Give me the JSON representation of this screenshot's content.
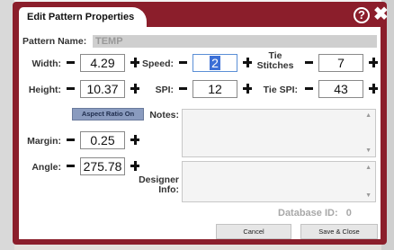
{
  "dialog": {
    "title": "Edit Pattern Properties",
    "help_icon": "?",
    "close_icon": "✖"
  },
  "pattern_name": {
    "label": "Pattern Name:",
    "value": "TEMP"
  },
  "fields": {
    "width": {
      "label": "Width:",
      "value": "4.29"
    },
    "height": {
      "label": "Height:",
      "value": "10.37"
    },
    "speed": {
      "label": "Speed:",
      "value": "2"
    },
    "spi": {
      "label": "SPI:",
      "value": "12"
    },
    "tie_stitches": {
      "label": "Tie Stitches",
      "value": "7"
    },
    "tie_spi": {
      "label": "Tie SPI:",
      "value": "43"
    },
    "margin": {
      "label": "Margin:",
      "value": "0.25"
    },
    "angle": {
      "label": "Angle:",
      "value": "275.78"
    }
  },
  "aspect_ratio_button": "Aspect Ratio On",
  "notes": {
    "label": "Notes:",
    "value": ""
  },
  "designer_info": {
    "label": "Designer Info:",
    "value": ""
  },
  "database_id": {
    "label": "Database ID:",
    "value": "0"
  },
  "buttons": {
    "cancel": "Cancel",
    "save_close": "Save & Close"
  }
}
